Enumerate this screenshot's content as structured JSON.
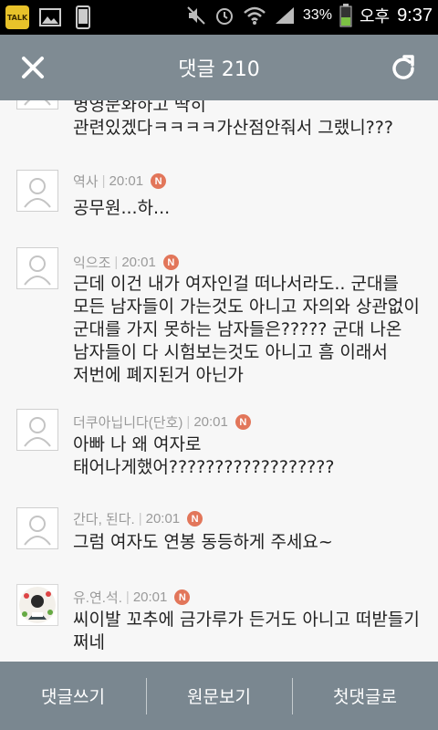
{
  "status_bar": {
    "battery": "33%",
    "ampm": "오후",
    "time": "9:37",
    "app_icons": [
      "talk-icon",
      "gallery-icon",
      "phone-icon"
    ],
    "talk_label": "TALK"
  },
  "header": {
    "title": "댓글 210",
    "close_icon": "close-icon",
    "refresh_icon": "refresh-icon"
  },
  "comments": [
    {
      "author": "",
      "time": "",
      "text": "병영문화하고 딱히\n관련있겠다ㅋㅋㅋㅋ가산점안줘서 그랬니???"
    },
    {
      "author": "역사",
      "time": "20:01",
      "badge": "N",
      "text": "공무원...하..."
    },
    {
      "author": "익으조",
      "time": "20:01",
      "badge": "N",
      "text": "근데 이건 내가 여자인걸 떠나서라도.. 군대를\n모든 남자들이 가는것도 아니고 자의와 상관없이\n군대를 가지 못하는 남자들은????? 군대 나온\n남자들이 다 시험보는것도 아니고 흠 이래서\n저번에 폐지된거 아닌가"
    },
    {
      "author": "더쿠아닙니다(단호)",
      "time": "20:01",
      "badge": "N",
      "text": "아빠 나 왜 여자로\n태어나게했어??????????????????"
    },
    {
      "author": "간다, 된다.",
      "time": "20:01",
      "badge": "N",
      "text": "그럼 여자도 연봉 동등하게 주세요~"
    },
    {
      "author": "유.연.석.",
      "time": "20:01",
      "badge": "N",
      "text": "씨이발 꼬추에 금가루가 든거도 아니고 떠받들기\n쩌네"
    }
  ],
  "footer": {
    "write": "댓글쓰기",
    "original": "원문보기",
    "first": "첫댓글로"
  },
  "colors": {
    "header_bg": "#7f8b93",
    "badge": "#e2765a",
    "footer_bg": "#7a8790"
  }
}
